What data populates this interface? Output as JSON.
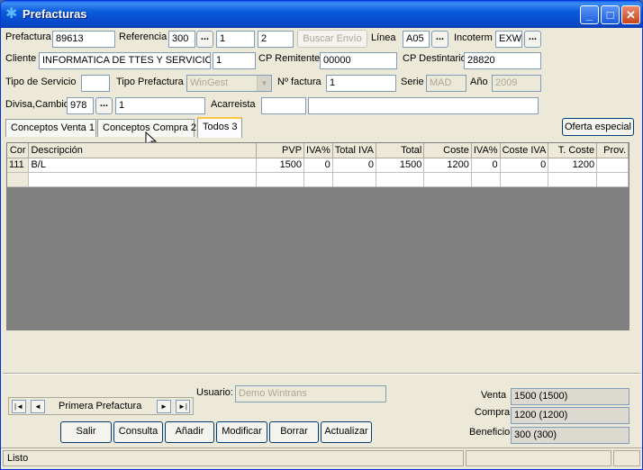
{
  "window": {
    "title": "Prefacturas"
  },
  "header": {
    "prefactura_label": "Prefactura",
    "prefactura_value": "89613",
    "referencia_label": "Referencia",
    "referencia_value": "300",
    "ref_btn": "...",
    "ref_field2": "1",
    "ref_field3": "2",
    "buscar_envio": "Buscar Envío",
    "linea_label": "Línea",
    "linea_value": "A05",
    "linea_btn": "...",
    "incoterm_label": "Incoterm",
    "incoterm_value": "EXW",
    "incoterm_btn": "...",
    "cliente_label": "Cliente",
    "cliente_value": "INFORMATICA DE TTES Y SERVICIO",
    "cliente_code": "1",
    "cp_remitente_label": "CP Remitente",
    "cp_remitente_value": "00000",
    "cp_destinatario_label": "CP Destintario",
    "cp_destinatario_value": "28820",
    "tipo_servicio_label": "Tipo de Servicio",
    "tipo_servicio_value": "",
    "tipo_prefactura_label": "Tipo Prefactura",
    "tipo_prefactura_value": "WinGest",
    "nfactura_label": "Nº factura",
    "nfactura_value": "1",
    "serie_label": "Serie",
    "serie_value": "MAD",
    "anio_label": "Año",
    "anio_value": "2009",
    "divisa_label": "Divisa,Cambio",
    "divisa_value": "978",
    "divisa_btn": "...",
    "cambio_value": "1",
    "acarreista_label": "Acarreista",
    "acarreista_code": "",
    "acarreista_value": ""
  },
  "tabs": [
    {
      "label": "Conceptos Venta 1"
    },
    {
      "label": "Conceptos Compra 2"
    },
    {
      "label": "Todos 3"
    }
  ],
  "oferta_especial": "Oferta especial",
  "grid": {
    "headers": [
      "Cor",
      "Descripción",
      "PVP",
      "IVA%",
      "Total IVA",
      "Total",
      "Coste",
      "IVA%",
      "Coste IVA",
      "T. Coste",
      "Prov."
    ],
    "rows": [
      [
        "111",
        "B/L",
        "1500",
        "0",
        "0",
        "1500",
        "1200",
        "0",
        "0",
        "1200",
        ""
      ]
    ]
  },
  "usuario_label": "Usuario:",
  "usuario_value": "Demo Wintrans",
  "nav": {
    "first": "|◄",
    "prev": "◄",
    "label": "Primera Prefactura",
    "next": "►",
    "last": "►|"
  },
  "buttons": {
    "salir": "Salir",
    "consulta": "Consulta",
    "anadir": "Añadir",
    "modificar": "Modificar",
    "borrar": "Borrar",
    "actualizar": "Actualizar"
  },
  "totals": {
    "venta_label": "Venta",
    "venta_value": "1500  (1500)",
    "compra_label": "Compra",
    "compra_value": "1200  (1200)",
    "beneficio_label": "Beneficio",
    "beneficio_value": "300  (300)"
  },
  "status": {
    "text": "Listo"
  },
  "colors": {
    "title_bar": "#0a5adc",
    "window_bg": "#ece9d8",
    "grid_bg": "#808080"
  }
}
